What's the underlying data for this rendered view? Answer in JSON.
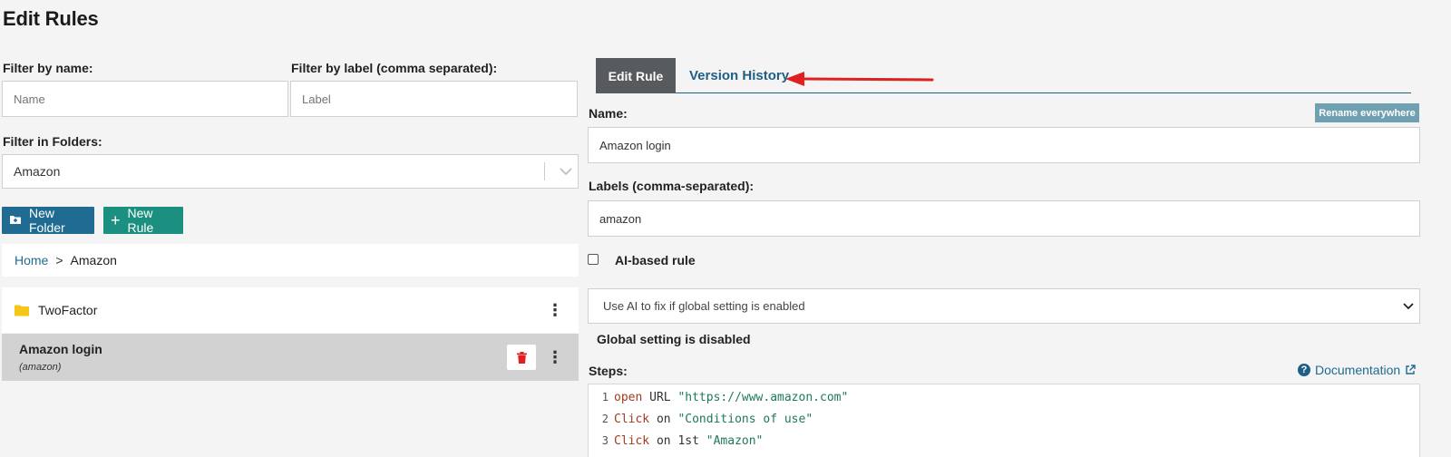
{
  "page": {
    "title": "Edit Rules"
  },
  "filters": {
    "by_name_label": "Filter by name:",
    "by_name_placeholder": "Name",
    "by_label_label": "Filter by label (comma separated):",
    "by_label_placeholder": "Label",
    "folders_label": "Filter in Folders:",
    "folders_value": "Amazon"
  },
  "actions": {
    "new_folder": "New Folder",
    "new_rule": "New Rule"
  },
  "breadcrumb": {
    "home": "Home",
    "separator": ">",
    "current": "Amazon"
  },
  "list": {
    "folder": {
      "name": "TwoFactor"
    },
    "rule": {
      "name": "Amazon login",
      "labels": "(amazon)"
    }
  },
  "tabs": {
    "edit": "Edit Rule",
    "history": "Version History"
  },
  "editor": {
    "name_label": "Name:",
    "rename_button": "Rename everywhere",
    "name_value": "Amazon login",
    "labels_label": "Labels (comma-separated):",
    "labels_value": "amazon",
    "ai_rule_label": "AI-based rule",
    "ai_select_value": "Use AI to fix if global setting is enabled",
    "global_status": "Global setting is disabled",
    "steps_label": "Steps:",
    "documentation": "Documentation",
    "steps": [
      {
        "n": "1",
        "kw": "open",
        "mid": " URL ",
        "str": "\"https://www.amazon.com\""
      },
      {
        "n": "2",
        "kw": "Click",
        "mid": " on ",
        "str": "\"Conditions of use\""
      },
      {
        "n": "3",
        "kw": "Click",
        "mid": " on 1st ",
        "str": "\"Amazon\""
      }
    ]
  },
  "colors": {
    "primary": "#1f6b92",
    "teal": "#1c9080",
    "accent_red": "#e02020",
    "tab_dark": "#575b5e"
  }
}
